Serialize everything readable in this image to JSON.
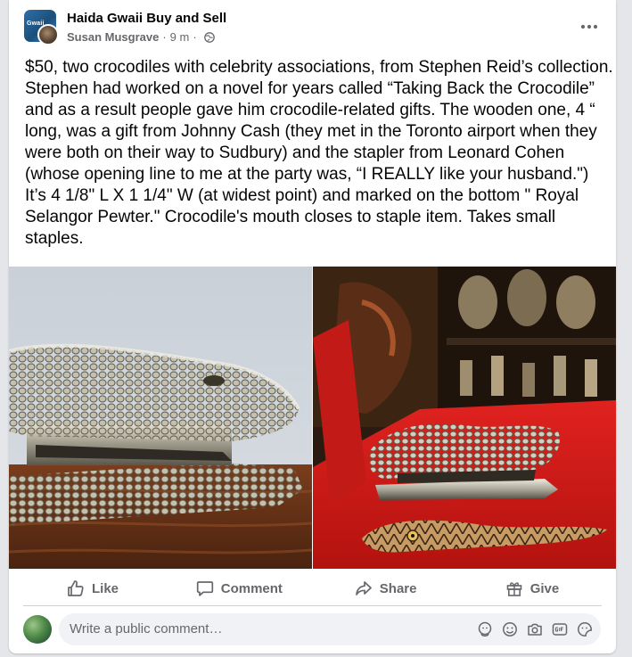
{
  "post": {
    "group_name": "Haida Gwaii Buy and Sell",
    "group_avatar_text": "Gwaii",
    "author": "Susan Musgrave",
    "separator": "·",
    "time": "9 m",
    "time_separator": "·",
    "privacy_icon": "globe-icon",
    "more_icon": "more-horizontal-icon",
    "text": "$50, two crocodiles with celebrity associations, from Stephen Reid’s collection. Stephen had worked on a novel for years called “Taking Back the Crocodile” and as a result people gave him crocodile-related gifts. The wooden one, 4 “ long, was a gift from Johnny Cash (they met in the Toronto airport when they were both on their way to Sudbury) and the stapler from Leonard Cohen (whose opening line to me at the party was, “I REALLY like your husband.\") It’s 4 1/8\" L X 1 1/4\" W (at widest point) and marked on the bottom \" Royal Selangor Pewter.\" Crocodile's mouth closes to staple item. Takes small staples."
  },
  "photos": [
    {
      "subject": "pewter crocodile stapler on wooden table"
    },
    {
      "subject": "pewter crocodile stapler and carved wooden crocodile on red surface"
    }
  ],
  "actions": {
    "like": {
      "label": "Like",
      "icon": "thumbs-up-icon"
    },
    "comment": {
      "label": "Comment",
      "icon": "comment-bubble-icon"
    },
    "share": {
      "label": "Share",
      "icon": "share-arrow-icon"
    },
    "give": {
      "label": "Give",
      "icon": "gift-icon"
    }
  },
  "comment": {
    "placeholder": "Write a public comment…",
    "tools": [
      "avatar-sticker-icon",
      "emoji-icon",
      "camera-icon",
      "gif-icon",
      "sticker-icon"
    ]
  },
  "colors": {
    "background": "#e4e6ea",
    "card": "#ffffff",
    "text_primary": "#050505",
    "text_secondary": "#65676b",
    "input_background": "#f0f2f5"
  }
}
